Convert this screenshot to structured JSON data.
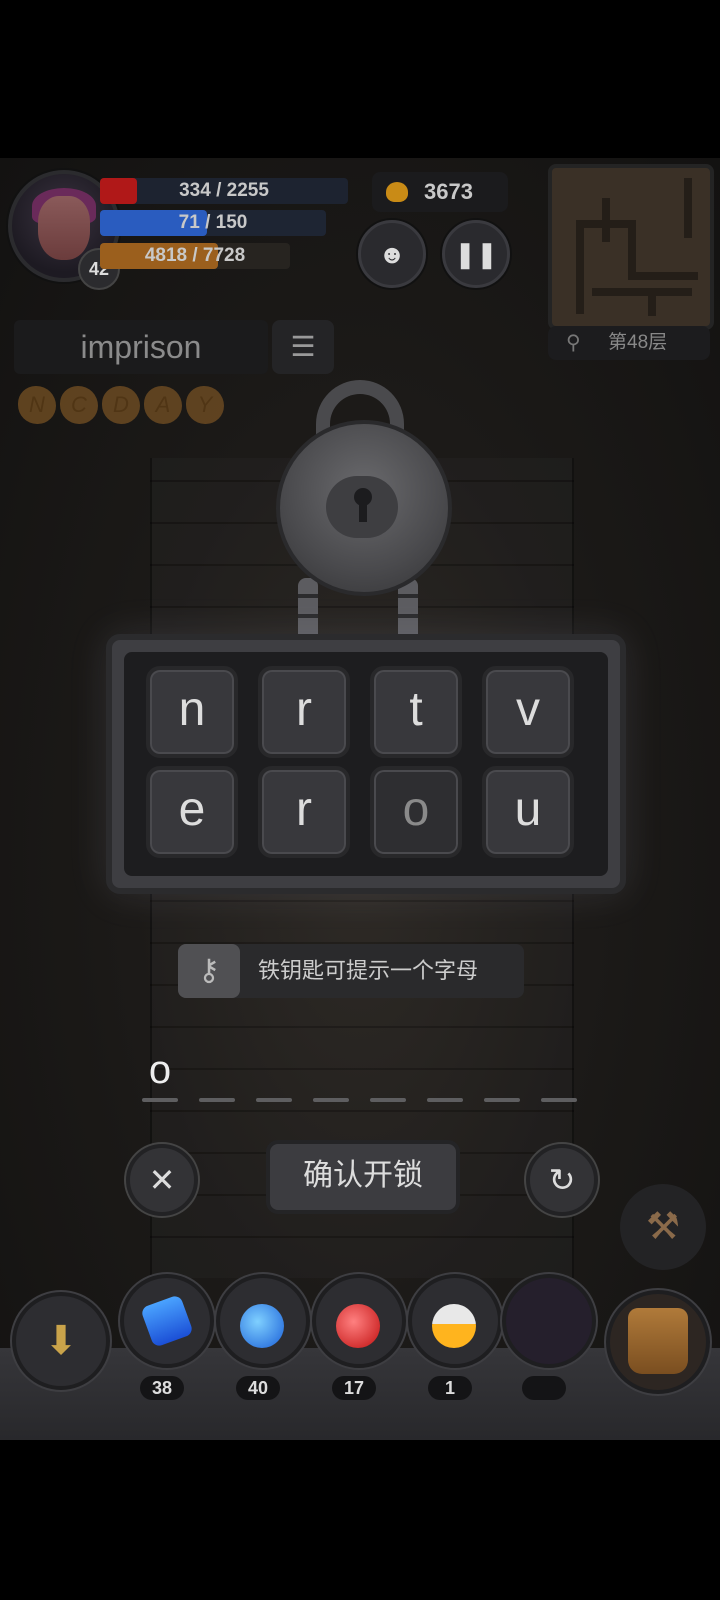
{
  "hud": {
    "level": "42",
    "hp_text": "334 / 2255",
    "hp_fraction": 0.148,
    "mp_text": "71 / 150",
    "mp_fraction": 0.473,
    "xp_text": "4818 / 7728",
    "xp_fraction": 0.623,
    "gold": "3673",
    "floor": "第48层",
    "icons": {
      "monster": "monster-face-icon",
      "pause": "pause-icon",
      "search": "magnifier-icon"
    }
  },
  "puzzle": {
    "word": "imprison",
    "used_letters": [
      "N",
      "C",
      "D",
      "A",
      "Y"
    ],
    "keys": [
      "n",
      "r",
      "t",
      "v",
      "e",
      "r",
      "o",
      "u"
    ],
    "used_key_indexes": [
      6
    ],
    "hint": "铁钥匙可提示一个字母",
    "answer": [
      "o",
      "",
      "",
      "",
      "",
      "",
      "",
      ""
    ],
    "confirm_label": "确认开锁",
    "clear_symbol": "✕",
    "reset_symbol": "↻"
  },
  "items": [
    {
      "name": "blue-elixir-bottle",
      "count": "38"
    },
    {
      "name": "blue-potion-flask",
      "count": "40"
    },
    {
      "name": "red-potion-flask",
      "count": "17"
    },
    {
      "name": "orange-potion-flask",
      "count": "1"
    },
    {
      "name": "empty-slot",
      "count": ""
    }
  ],
  "colors": {
    "hp": "#b01818",
    "mp": "#2a5cbf",
    "xp": "#9b5f1d",
    "gold": "#c98b16"
  }
}
